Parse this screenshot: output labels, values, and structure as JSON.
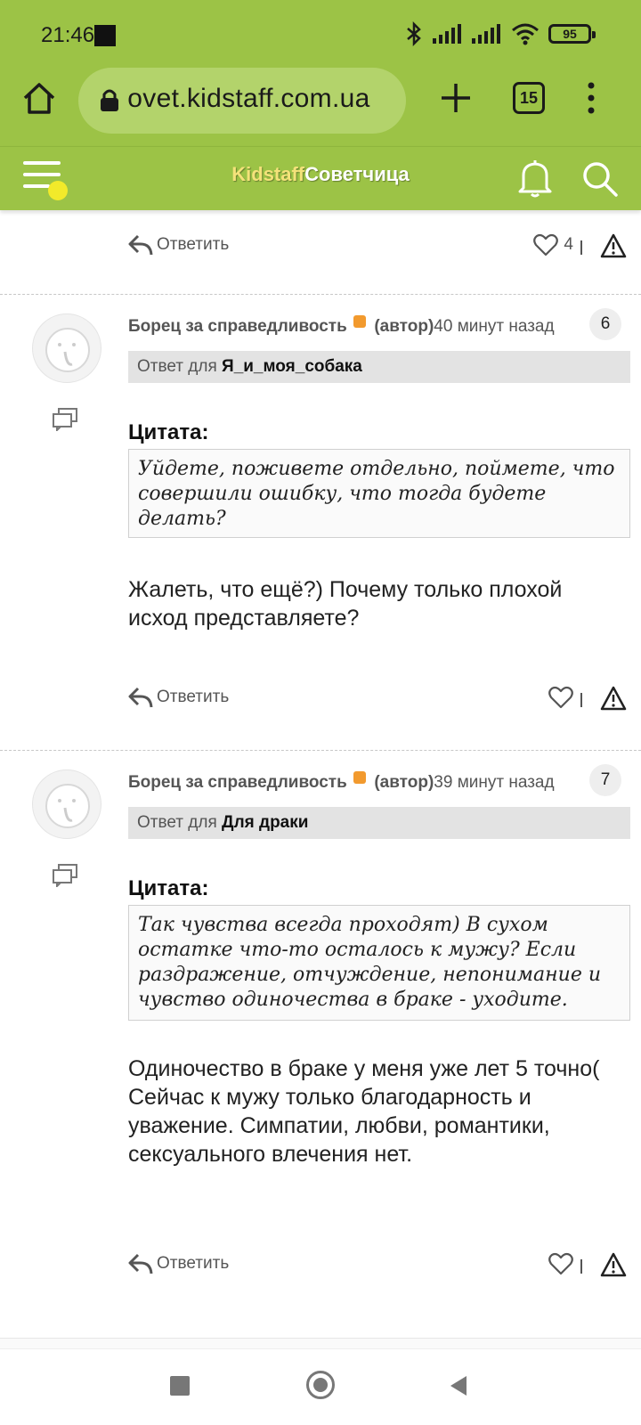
{
  "status": {
    "time": "21:46",
    "battery": "95"
  },
  "browser": {
    "url": "sovet.kidstaff.com.ua",
    "tab_count": "15"
  },
  "header": {
    "brand_part1": "Kidstaff",
    "brand_part2": "Советчица"
  },
  "top_row": {
    "reply_label": "Ответить",
    "like_count": "4"
  },
  "posts": [
    {
      "author": "Борец за справедливость",
      "author_tag": "(автор)",
      "time": "40 минут назад",
      "number": "6",
      "reply_to_prefix": "Ответ для",
      "reply_to_user": "Я_и_моя_собака",
      "quote_label": "Цитата:",
      "quote": "Уйдете, поживете отдельно, поймете, что совершили ошибку, что тогда будете делать?",
      "body": "Жалеть, что ещё?) Почему только плохой исход представляете?",
      "reply_label": "Ответить",
      "like_count": ""
    },
    {
      "author": "Борец за справедливость",
      "author_tag": "(автор)",
      "time": "39 минут назад",
      "number": "7",
      "reply_to_prefix": "Ответ для",
      "reply_to_user": "Для драки",
      "quote_label": "Цитата:",
      "quote": "Так чувства всегда проходят) В сухом остатке что-то осталось к мужу? Если раздражение, отчуждение, непонимание и чувство одиночества в браке - уходите.",
      "body": "Одиночество в браке у меня уже лет 5 точно( Сейчас к мужу только благодарность и уважение. Симпатии, любви, романтики, сексуального влечения нет.",
      "reply_label": "Ответить",
      "like_count": ""
    }
  ],
  "colors": {
    "accent": "#9cc346",
    "author_dot": "#f29a2e"
  }
}
